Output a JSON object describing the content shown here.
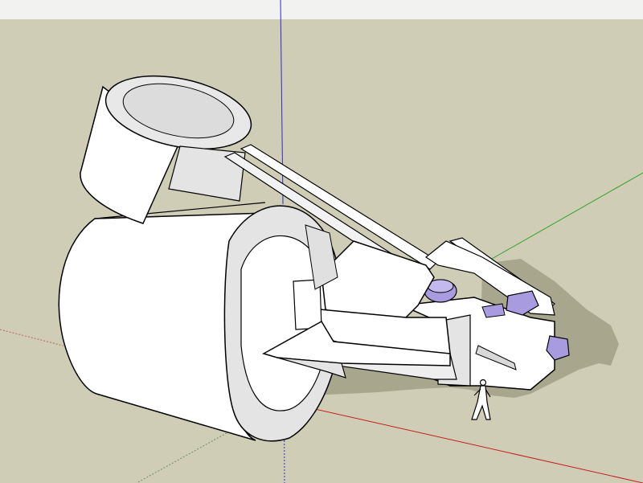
{
  "viewport": {
    "sky_color": "#f2f2f0",
    "ground_color": "#cfcdb5",
    "shadow_color": "#a9a68e"
  },
  "axes": {
    "red_axis_color": "#c81e1e",
    "green_axis_color": "#2fa52f",
    "blue_axis_color": "#2b2bd2",
    "dotted_axis_color": "#8f8f7f"
  },
  "model": {
    "face_color": "#ffffff",
    "shaded_face_color": "#e4e4e4",
    "edge_color": "#000000",
    "glass_color": "#a99be0",
    "icons": [
      "scale-figure-icon"
    ]
  }
}
